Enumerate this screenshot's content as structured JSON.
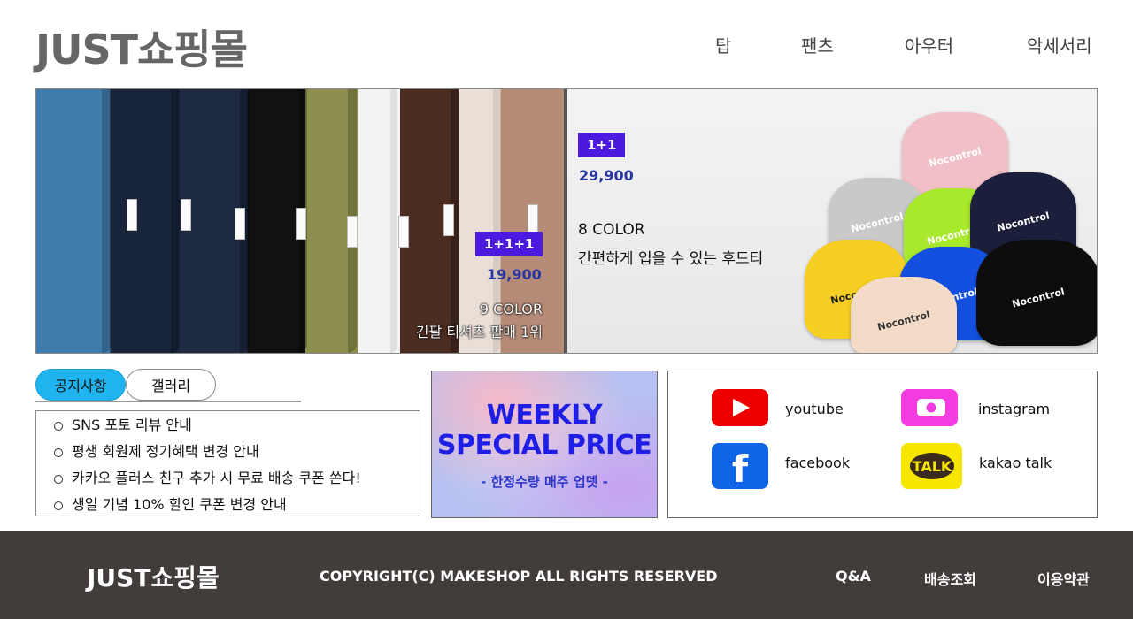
{
  "header": {
    "logo": "JUST쇼핑몰",
    "nav": [
      "탑",
      "팬츠",
      "아우터",
      "악세서리"
    ]
  },
  "hero": {
    "left": {
      "badge": "1+1+1",
      "price": "19,900",
      "caption_line1": "9 COLOR",
      "caption_line2": "긴팔 티셔츠 판매 1위"
    },
    "right": {
      "badge": "1+1",
      "price": "29,900",
      "line1": "8 COLOR",
      "line2": "간편하게 입을 수 있는 후드티",
      "hoodie_brand": "Nocontrol"
    }
  },
  "tabs": {
    "notice": "공지사항",
    "gallery": "갤러리"
  },
  "notices": [
    "SNS 포토 리뷰 안내",
    "평생 회원제 정기혜택 변경 안내",
    "카카오 플러스 친구 추가 시 무료 배송 쿠폰 쏜다!",
    "생일 기념 10% 할인 쿠폰 변경 안내"
  ],
  "weekly": {
    "line1": "WEEKLY",
    "line2": "SPECIAL PRICE",
    "sub": "- 한정수량 매주 업뎃 -"
  },
  "social": {
    "youtube": "youtube",
    "instagram": "instagram",
    "facebook": "facebook",
    "kakao": "kakao talk",
    "kakao_icon_text": "TALK",
    "facebook_icon_text": "f"
  },
  "footer": {
    "logo": "JUST쇼핑몰",
    "copyright": "COPYRIGHT(C) MAKESHOP ALL RIGHTS RESERVED",
    "links": [
      "Q&A",
      "배송조회",
      "이용약관"
    ]
  },
  "colors": {
    "accent_badge": "#4c1adf",
    "tab_active": "#1fb4ef",
    "footer_bg": "#423d3b",
    "youtube": "#ee0000",
    "instagram": "#f53ce0",
    "facebook": "#1064e6",
    "kakao": "#f7e600"
  }
}
